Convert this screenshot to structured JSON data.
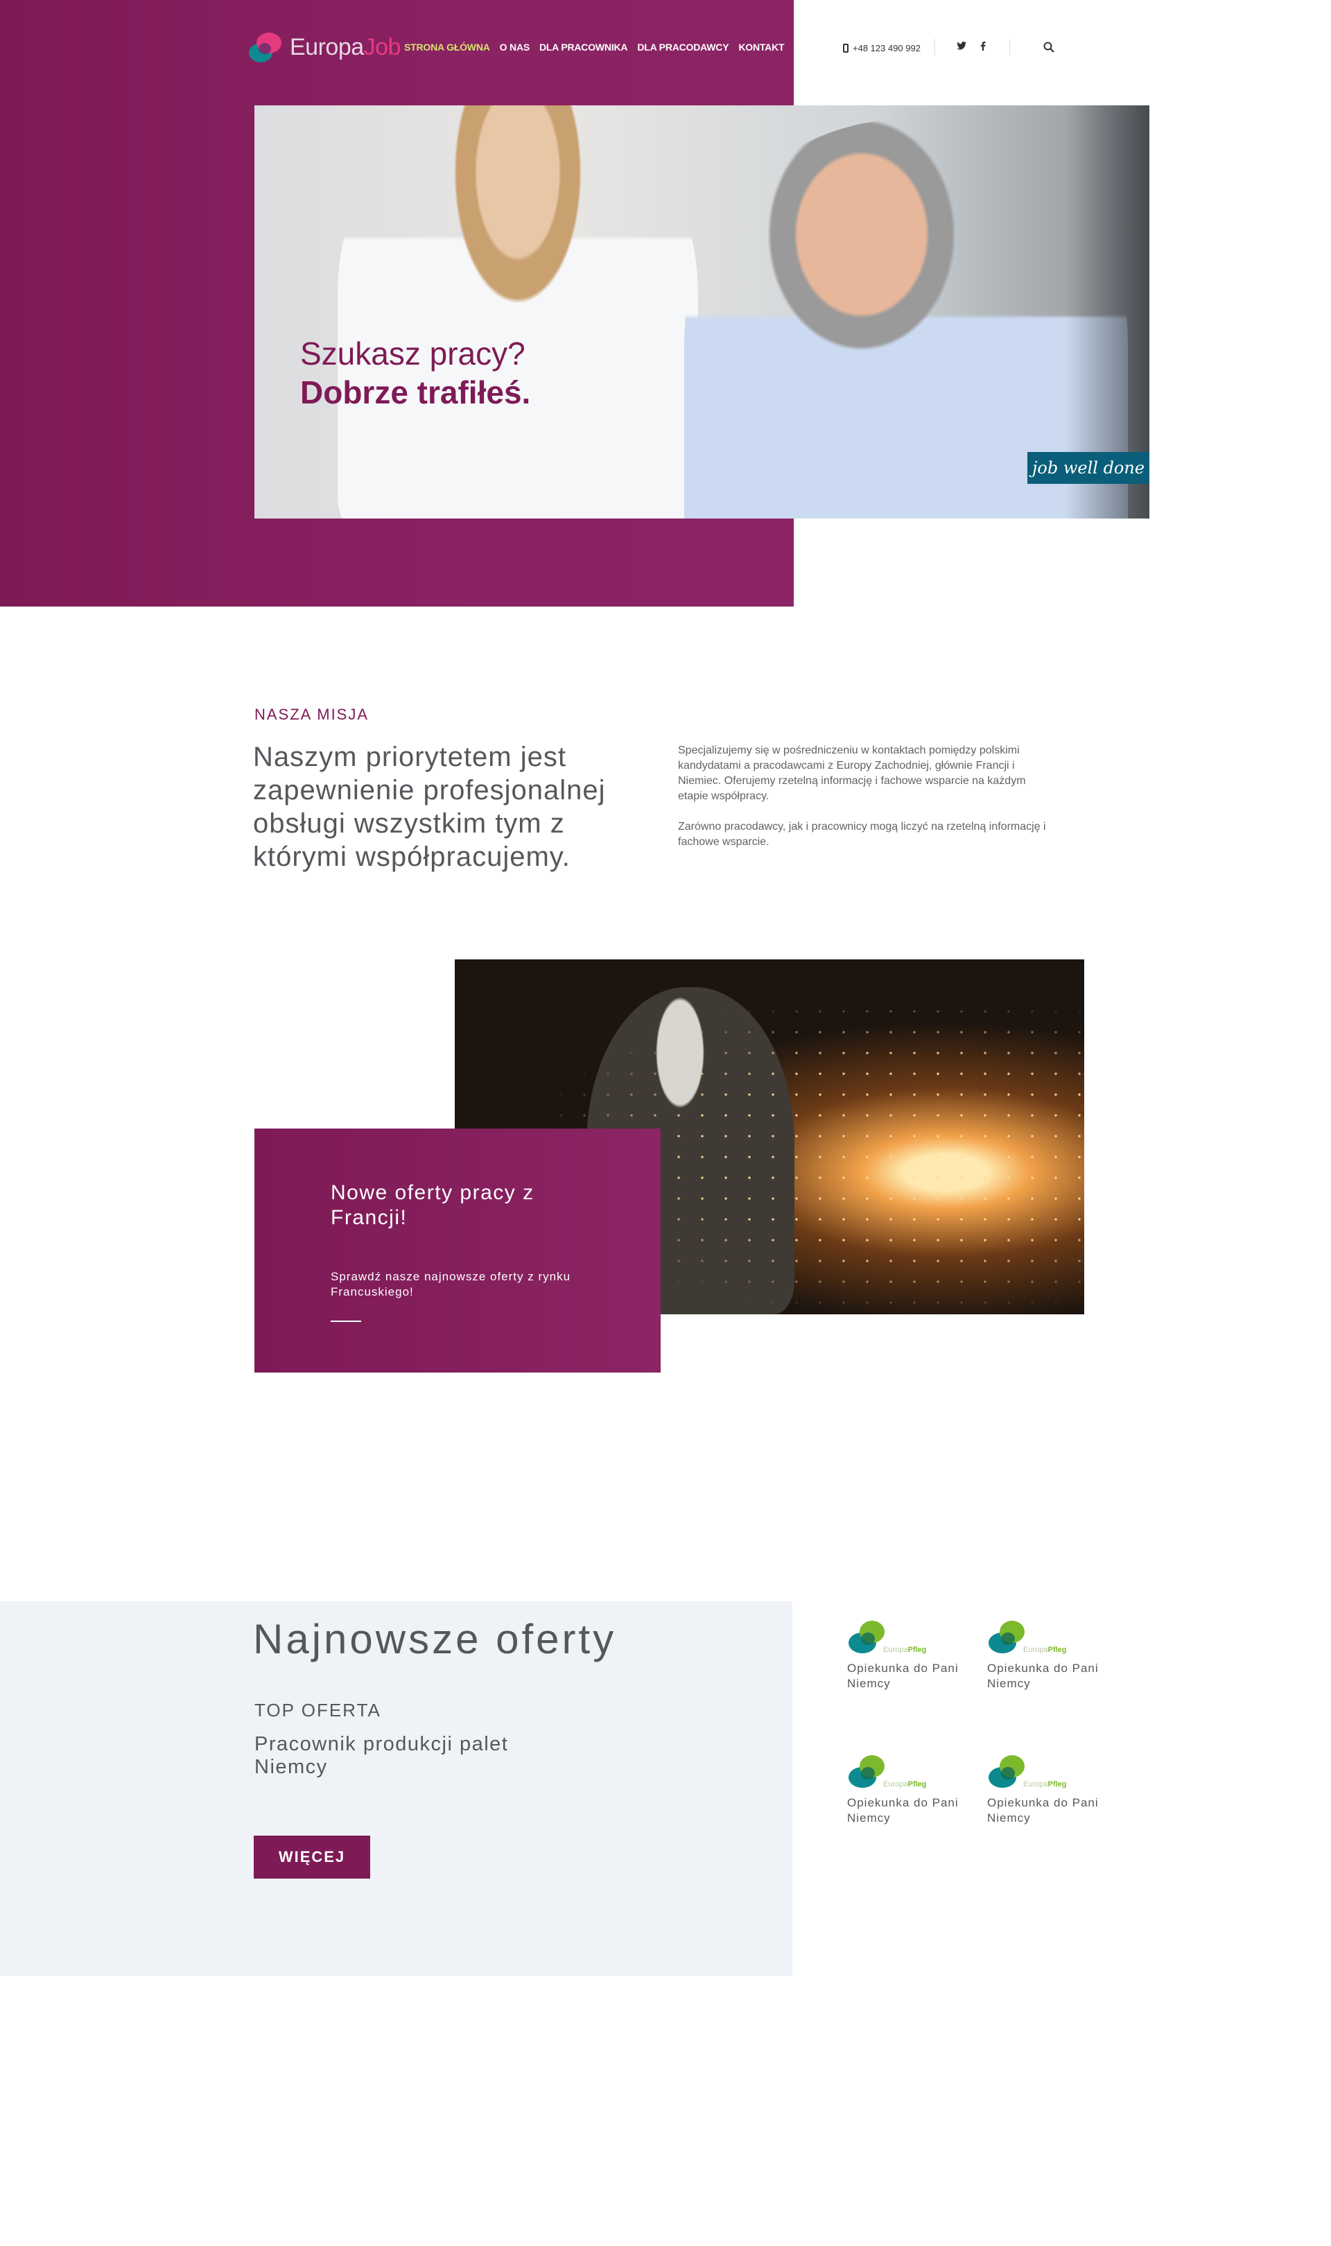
{
  "header": {
    "logo": {
      "part1": "Europa",
      "part2": "Job"
    },
    "nav": [
      {
        "label": "STRONA GŁÓWNA",
        "active": true
      },
      {
        "label": "O NAS"
      },
      {
        "label": "DLA PRACOWNIKA"
      },
      {
        "label": "DLA PRACODAWCY"
      },
      {
        "label": "KONTAKT"
      }
    ],
    "phone": "+48 123 490 992",
    "social": [
      "twitter-icon",
      "facebook-icon"
    ],
    "search_icon": "search-icon"
  },
  "hero": {
    "line1": "Szukasz pracy?",
    "line2": "Dobrze trafiłeś.",
    "badge": "job well done"
  },
  "mission": {
    "label": "NASZA MISJA",
    "title": "Naszym priorytetem jest zapewnienie profesjonalnej obsługi wszystkim tym z którymi współpracujemy.",
    "paragraph1": "Specjalizujemy się w pośredniczeniu w kontaktach pomiędzy polskimi kandydatami a pracodawcami z Europy Zachodniej, głównie Francji i Niemiec. Oferujemy rzetelną informację i fachowe wsparcie na każdym etapie współpracy.",
    "paragraph2": "Zarówno pracodawcy, jak i pracownicy mogą liczyć na rzetelną informację i fachowe wsparcie."
  },
  "promo": {
    "title": "Nowe oferty pracy z Francji!",
    "subtitle": "Sprawdź nasze najnowsze oferty z rynku Francuskiego!"
  },
  "offers": {
    "title": "Najnowsze oferty",
    "top_label": "TOP OFERTA",
    "top_job": "Pracownik produkcji palet Niemcy",
    "button": "WIĘCEJ",
    "jobs": [
      {
        "logo_a": "Europa",
        "logo_b": "Pfleg",
        "name": "Opiekunka do Pani Niemcy"
      },
      {
        "logo_a": "Europa",
        "logo_b": "Pfleg",
        "name": "Opiekunka do Pani Niemcy"
      },
      {
        "logo_a": "Europa",
        "logo_b": "Pfleg",
        "name": "Opiekunka do Pani Niemcy"
      },
      {
        "logo_a": "Europa",
        "logo_b": "Pfleg",
        "name": "Opiekunka do Pani Niemcy"
      }
    ]
  },
  "colors": {
    "brand_primary": "#7e1a56",
    "brand_accent": "#e63a80",
    "nav_active": "#d7e36a",
    "badge_bg": "#0a5e7a",
    "offers_bg": "#eff3f7",
    "logo_green": "#7db92c",
    "logo_teal": "#0c8a8f"
  }
}
